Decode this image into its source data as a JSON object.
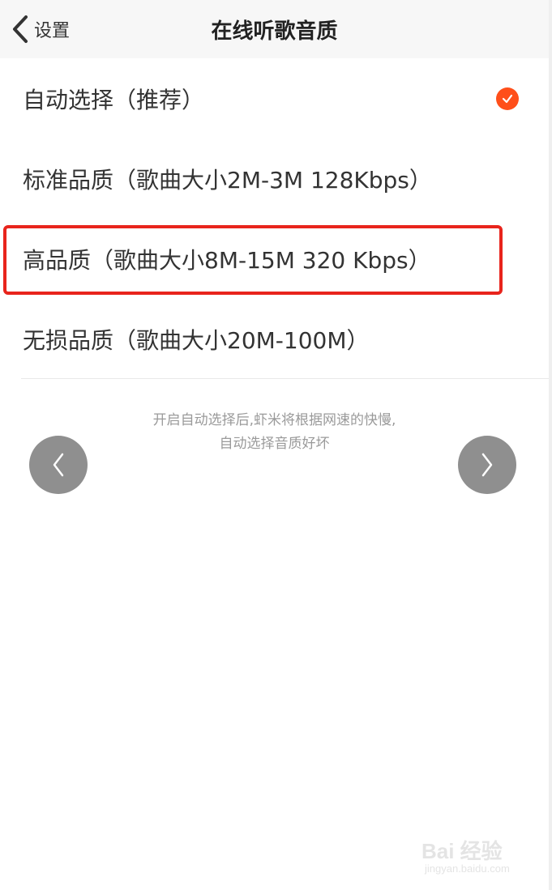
{
  "header": {
    "back_label": "设置",
    "title": "在线听歌音质"
  },
  "options": [
    {
      "label": "自动选择（推荐）",
      "selected": true
    },
    {
      "label": "标准品质（歌曲大小2M-3M 128Kbps）",
      "selected": false
    },
    {
      "label": "高品质（歌曲大小8M-15M 320 Kbps）",
      "selected": false,
      "highlighted": true
    },
    {
      "label": "无损品质（歌曲大小20M-100M）",
      "selected": false
    }
  ],
  "hint": {
    "line1": "开启自动选择后,虾米将根据网速的快慢,",
    "line2": "自动选择音质好坏"
  },
  "watermark": {
    "brand": "Bai 经验",
    "site": "jingyan.baidu.com"
  },
  "colors": {
    "accent": "#ff4f1a",
    "highlight_box": "#e8241c",
    "nav_button": "#8f8f8f"
  }
}
